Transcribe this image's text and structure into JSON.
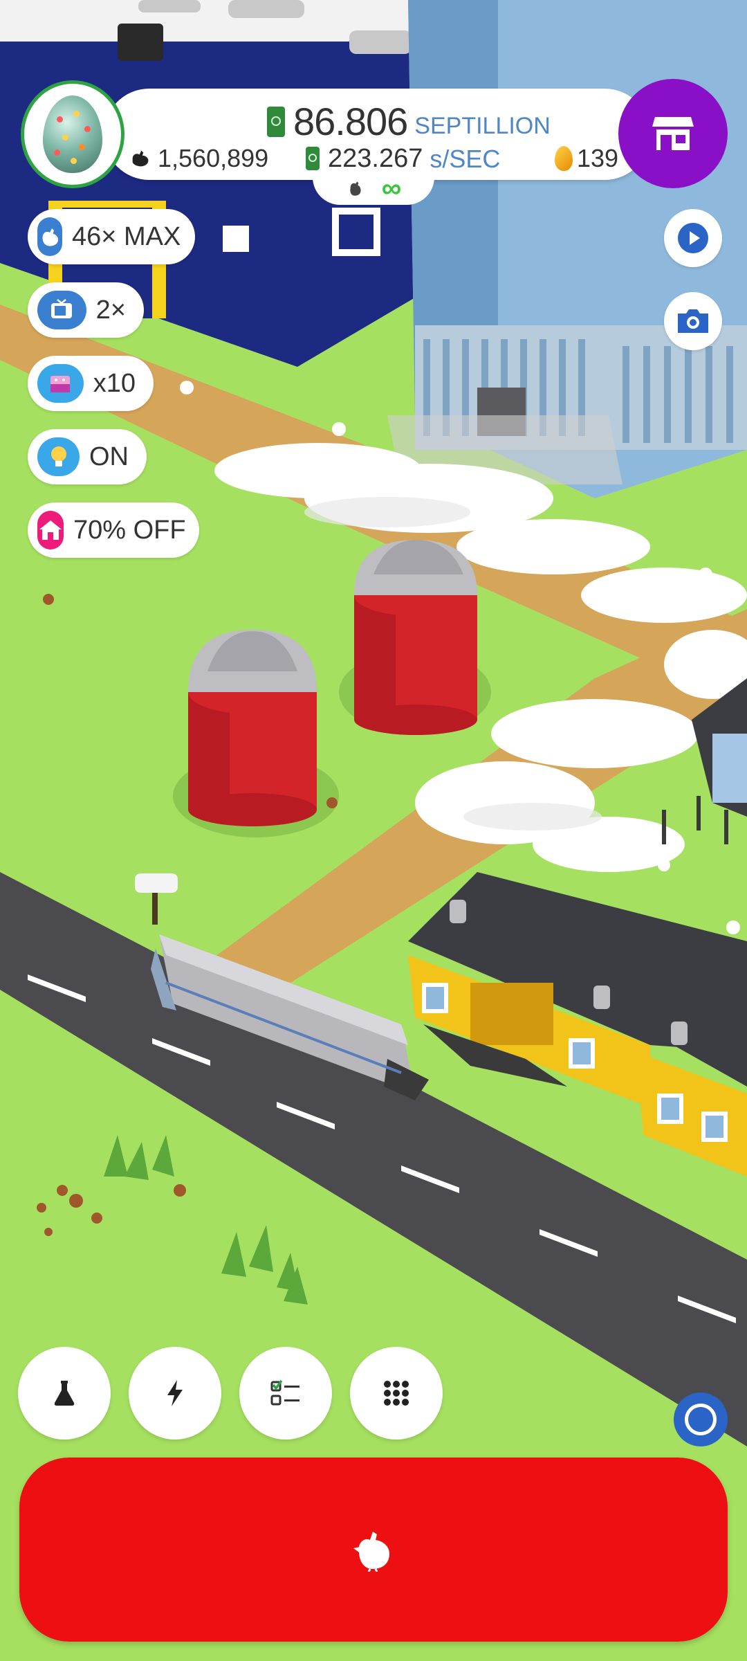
{
  "hud": {
    "money_value": "86.806",
    "money_unit": "SEPTILLION",
    "chicken_count": "1,560,899",
    "earnings_rate": "223.267",
    "earnings_unit": "s/SEC",
    "golden_eggs": "139",
    "infinity_symbol": "∞"
  },
  "boosts": [
    {
      "label": "46× MAX",
      "icon": "chicken-icon",
      "color": "#3b7fd0"
    },
    {
      "label": "2×",
      "icon": "tv-icon",
      "color": "#3b7fd0"
    },
    {
      "label": "x10",
      "icon": "boost-box-icon",
      "color": "#3aa8e8"
    },
    {
      "label": "ON",
      "icon": "lightbulb-icon",
      "color": "#3aa8e8"
    },
    {
      "label": "70% OFF",
      "icon": "home-icon",
      "color": "#ee1b7a"
    }
  ],
  "side_buttons": [
    "play-icon",
    "camera-icon"
  ],
  "tool_buttons": [
    "research-flask-icon",
    "lightning-icon",
    "checklist-icon",
    "grid-menu-icon"
  ],
  "hatch_button": {
    "icon": "chicken-icon"
  },
  "colors": {
    "grass": "#a6e060",
    "road": "#4b4b4f",
    "path": "#d5a55a",
    "silo_red": "#d3242a",
    "barn_yellow": "#f2c319",
    "barn_roof": "#3c3d42",
    "building_blue": "#1d2a82",
    "tower_glass": "#8fb9dc",
    "shop_purple": "#8a10c8",
    "hatch_red": "#ee0f12"
  }
}
